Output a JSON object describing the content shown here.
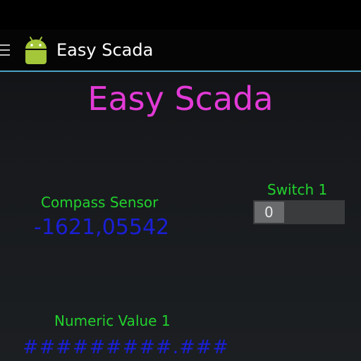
{
  "app_bar": {
    "title": "Easy Scada",
    "menu_icon": "hamburger-menu-icon",
    "app_icon": "android-robot-icon",
    "divider_color": "#4aa3c8"
  },
  "main": {
    "title": "Easy Scada",
    "title_color": "#e23ad6",
    "compass": {
      "label": "Compass Sensor",
      "value": "-1621,05542"
    },
    "switch1": {
      "label": "Switch 1",
      "value": "0"
    },
    "numeric1": {
      "label": "Numeric Value 1",
      "value": "#########.###"
    },
    "label_color": "#22d22e",
    "value_color": "#1a1fd6"
  }
}
